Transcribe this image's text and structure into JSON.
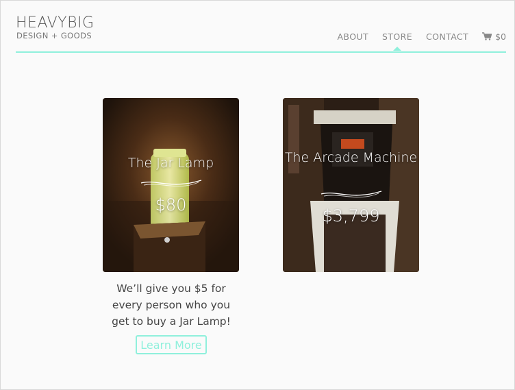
{
  "brand": {
    "name": "HEAVYBIG",
    "tagline": "DESIGN + GOODS"
  },
  "nav": {
    "items": [
      {
        "label": "ABOUT",
        "active": false
      },
      {
        "label": "STORE",
        "active": true
      },
      {
        "label": "CONTACT",
        "active": false
      }
    ],
    "cart": {
      "icon": "cart-icon",
      "total": "$0"
    }
  },
  "products": [
    {
      "title": "The Jar Lamp",
      "price": "$80"
    },
    {
      "title": "The Arcade Machine",
      "price": "$3,799"
    }
  ],
  "promo": {
    "text": "We’ll give you $5 for every person who you get to buy a Jar Lamp!",
    "button_label": "Learn More"
  },
  "colors": {
    "accent": "#8ff0dc",
    "background": "#fafafa"
  }
}
